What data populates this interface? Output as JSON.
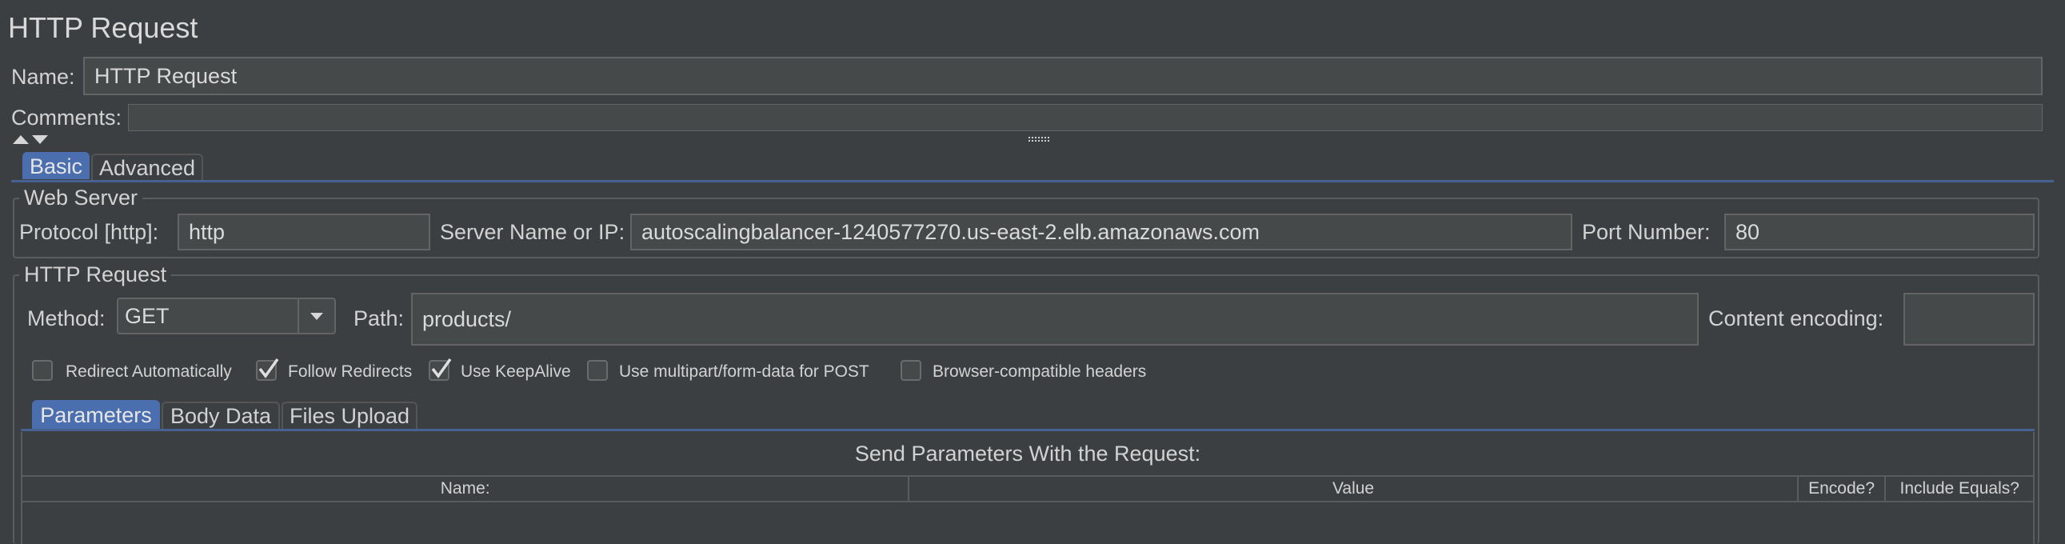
{
  "panel": {
    "title": "HTTP Request",
    "name_label": "Name:",
    "name_value": "HTTP Request",
    "comments_label": "Comments:",
    "comments_value": ""
  },
  "main_tabs": [
    {
      "label": "Basic",
      "active": true
    },
    {
      "label": "Advanced",
      "active": false
    }
  ],
  "web_server": {
    "group_title": "Web Server",
    "protocol_label": "Protocol [http]:",
    "protocol_value": "http",
    "server_label": "Server Name or IP:",
    "server_value": "autoscalingbalancer-1240577270.us-east-2.elb.amazonaws.com",
    "port_label": "Port Number:",
    "port_value": "80"
  },
  "http_request": {
    "group_title": "HTTP Request",
    "method_label": "Method:",
    "method_value": "GET",
    "path_label": "Path:",
    "path_value": "products/",
    "encoding_label": "Content encoding:",
    "encoding_value": ""
  },
  "options": [
    {
      "label": "Redirect Automatically",
      "checked": false
    },
    {
      "label": "Follow Redirects",
      "checked": true
    },
    {
      "label": "Use KeepAlive",
      "checked": true
    },
    {
      "label": "Use multipart/form-data for POST",
      "checked": false
    },
    {
      "label": "Browser-compatible headers",
      "checked": false
    }
  ],
  "param_tabs": [
    {
      "label": "Parameters",
      "active": true
    },
    {
      "label": "Body Data",
      "active": false
    },
    {
      "label": "Files Upload",
      "active": false
    }
  ],
  "params_table": {
    "caption": "Send Parameters With the Request:",
    "columns": [
      "Name:",
      "Value",
      "Encode?",
      "Include Equals?"
    ]
  },
  "colors": {
    "background": "#3c3f41",
    "field": "#45494a",
    "accent": "#4b6eaf"
  }
}
